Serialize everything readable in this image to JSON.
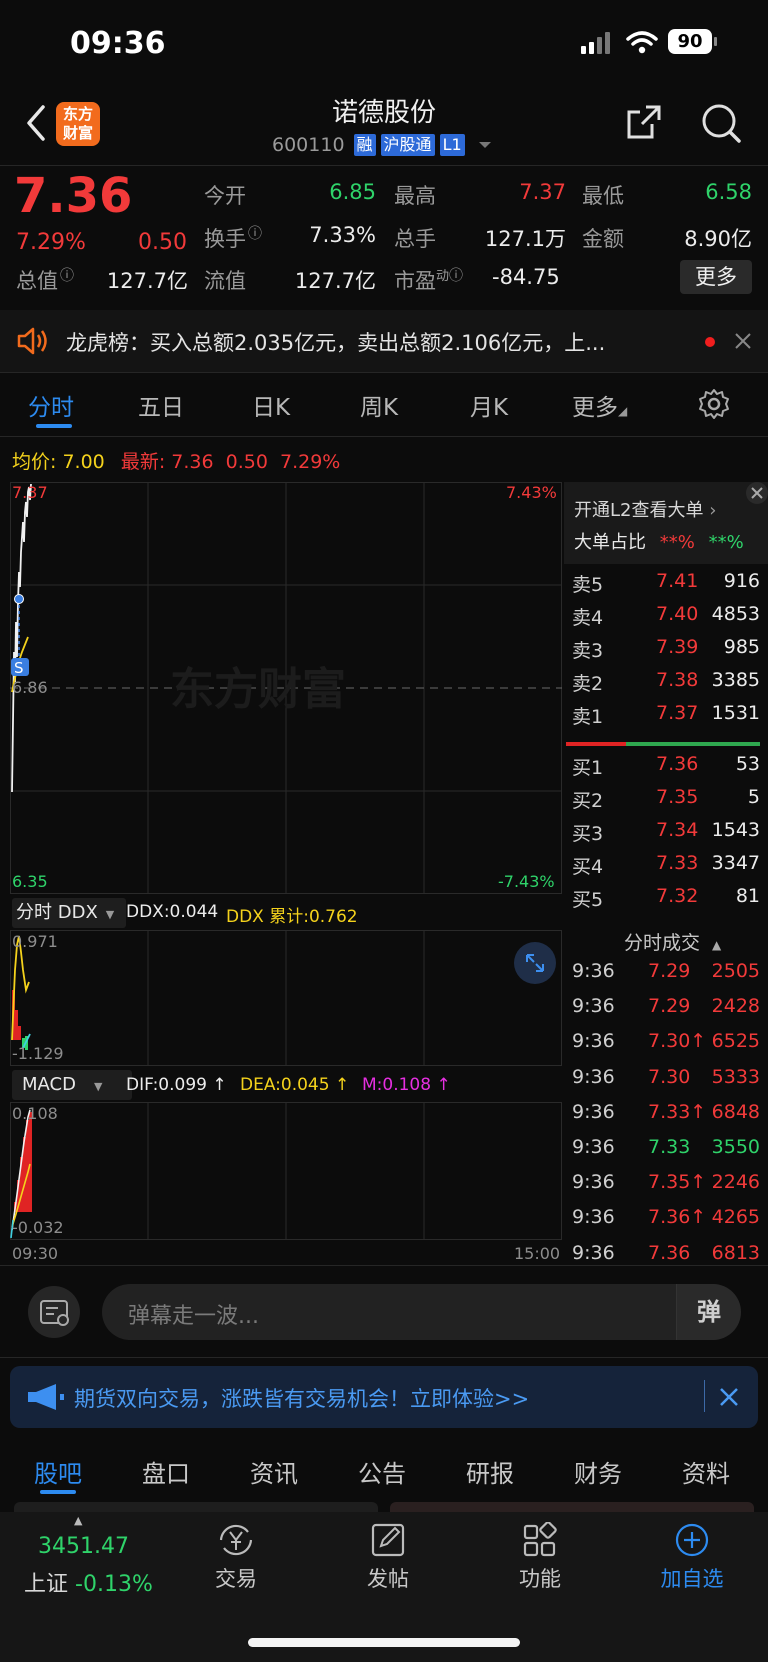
{
  "status": {
    "time": "09:36",
    "battery": "90"
  },
  "header": {
    "logo_line1": "东方",
    "logo_line2": "财富",
    "title": "诺德股份",
    "code": "600110",
    "tags": [
      "融",
      "沪股通",
      "L1"
    ]
  },
  "quote": {
    "price": "7.36",
    "change_pct": "7.29%",
    "change_amt": "0.50",
    "open_label": "今开",
    "open": "6.85",
    "high_label": "最高",
    "high": "7.37",
    "low_label": "最低",
    "low": "6.58",
    "turnover_label": "换手",
    "turnover": "7.33%",
    "volume_label": "总手",
    "volume": "127.1万",
    "amount_label": "金额",
    "amount": "8.90亿",
    "mktcap_label": "总值",
    "mktcap": "127.7亿",
    "float_label": "流值",
    "float": "127.7亿",
    "pe_label": "市盈",
    "pe_sup": "动",
    "pe": "-84.75",
    "more_button": "更多"
  },
  "ticker": {
    "text": "龙虎榜：买入总额2.035亿元，卖出总额2.106亿元，上..."
  },
  "chart_tabs": [
    "分时",
    "五日",
    "日K",
    "周K",
    "月K",
    "更多"
  ],
  "intraday": {
    "avg_label": "均价:",
    "avg": "7.00",
    "latest_label": "最新:",
    "latest": "7.36",
    "latest_chg": "0.50",
    "latest_pct": "7.29%",
    "y_top": "7.37",
    "y_mid": "6.86",
    "y_bottom": "6.35",
    "pct_top": "7.43%",
    "pct_bottom": "-7.43%",
    "watermark": "东方财富",
    "marker": "S"
  },
  "ddx": {
    "selector": "分时 DDX",
    "ddx_label": "DDX:0.044",
    "ddx_cum": "DDX 累计:0.762",
    "y_top": "0.971",
    "y_bottom": "-1.129"
  },
  "macd": {
    "selector": "MACD",
    "dif": "DIF:0.099 ↑",
    "dea": "DEA:0.045 ↑",
    "m": "M:0.108 ↑",
    "y_top": "0.108",
    "y_bottom": "-0.032",
    "t_start": "09:30",
    "t_end": "15:00"
  },
  "l2": {
    "title": "开通L2查看大单",
    "ratio_label": "大单占比",
    "ratio_buy": "**%",
    "ratio_sell": "**%"
  },
  "orderbook": {
    "asks": [
      {
        "label": "卖5",
        "price": "7.41",
        "qty": "916"
      },
      {
        "label": "卖4",
        "price": "7.40",
        "qty": "4853"
      },
      {
        "label": "卖3",
        "price": "7.39",
        "qty": "985"
      },
      {
        "label": "卖2",
        "price": "7.38",
        "qty": "3385"
      },
      {
        "label": "卖1",
        "price": "7.37",
        "qty": "1531"
      }
    ],
    "bids": [
      {
        "label": "买1",
        "price": "7.36",
        "qty": "53"
      },
      {
        "label": "买2",
        "price": "7.35",
        "qty": "5"
      },
      {
        "label": "买3",
        "price": "7.34",
        "qty": "1543"
      },
      {
        "label": "买4",
        "price": "7.33",
        "qty": "3347"
      },
      {
        "label": "买5",
        "price": "7.32",
        "qty": "81"
      }
    ]
  },
  "trades": {
    "title": "分时成交",
    "rows": [
      {
        "time": "9:36",
        "price": "7.29",
        "qty": "2505",
        "pc": "red",
        "qc": "red"
      },
      {
        "time": "9:36",
        "price": "7.29",
        "qty": "2428",
        "pc": "red",
        "qc": "red"
      },
      {
        "time": "9:36",
        "price": "7.30↑",
        "qty": "6525",
        "pc": "red",
        "qc": "red"
      },
      {
        "time": "9:36",
        "price": "7.30",
        "qty": "5333",
        "pc": "red",
        "qc": "red"
      },
      {
        "time": "9:36",
        "price": "7.33↑",
        "qty": "6848",
        "pc": "red",
        "qc": "red"
      },
      {
        "time": "9:36",
        "price": "7.33",
        "qty": "3550",
        "pc": "green",
        "qc": "green"
      },
      {
        "time": "9:36",
        "price": "7.35↑",
        "qty": "2246",
        "pc": "red",
        "qc": "red"
      },
      {
        "time": "9:36",
        "price": "7.36↑",
        "qty": "4265",
        "pc": "red",
        "qc": "red"
      },
      {
        "time": "9:36",
        "price": "7.36",
        "qty": "6813",
        "pc": "red",
        "qc": "red"
      }
    ]
  },
  "danmu": {
    "placeholder": "弹幕走一波...",
    "button": "弹"
  },
  "promo": {
    "text": "期货双向交易，涨跌皆有交易机会！立即体验>>"
  },
  "bottom_tabs": [
    "股吧",
    "盘口",
    "资讯",
    "公告",
    "研报",
    "财务",
    "资料"
  ],
  "navbar": {
    "index_value": "3451.47",
    "index_name": "上证",
    "index_change": "-0.13%",
    "items": [
      "交易",
      "发帖",
      "功能",
      "加自选"
    ]
  },
  "colors": {
    "up": "#f23a3a",
    "down": "#2fd36a",
    "accent": "#2d8bf0",
    "avg_line": "#f4d21c"
  }
}
